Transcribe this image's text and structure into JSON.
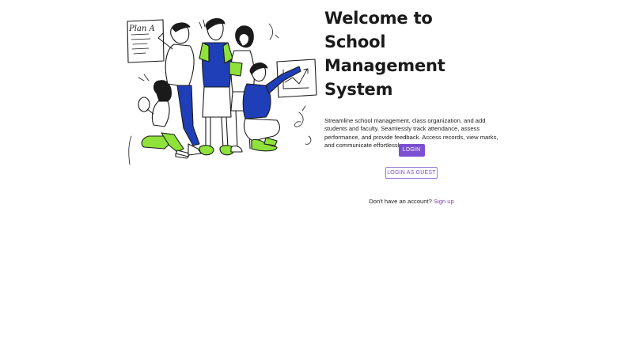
{
  "illustration": {
    "board_text": "Plan A"
  },
  "hero": {
    "title_line1": "Welcome to",
    "title_line2": "School Management",
    "title_line3": "System",
    "description": "Streamline school management, class organization, and add students and faculty. Seamlessly track attendance, assess performance, and provide feedback. Access records, view marks, and communicate effortlessly."
  },
  "actions": {
    "login_label": "LOGIN",
    "guest_label": "LOGIN AS GUEST"
  },
  "signup": {
    "prompt": "Don't have an account?",
    "link_label": "Sign up"
  },
  "colors": {
    "accent": "#7c4fd0",
    "illustration_blue": "#1f3fb8",
    "illustration_green": "#8ee23a"
  }
}
